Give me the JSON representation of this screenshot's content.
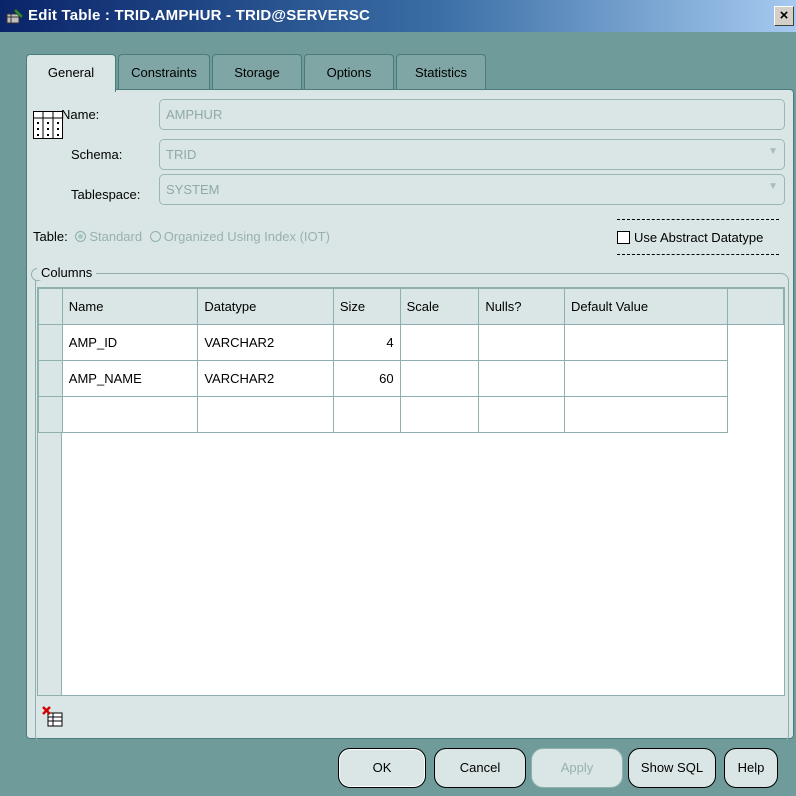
{
  "window": {
    "title": "Edit Table : TRID.AMPHUR - TRID@SERVERSC",
    "close_glyph": "×",
    "icon": "table-edit-icon"
  },
  "tabs": [
    {
      "label": "General",
      "active": true
    },
    {
      "label": "Constraints",
      "active": false
    },
    {
      "label": "Storage",
      "active": false
    },
    {
      "label": "Options",
      "active": false
    },
    {
      "label": "Statistics",
      "active": false
    }
  ],
  "general": {
    "name_label": "Name:",
    "name_value": "AMPHUR",
    "schema_label": "Schema:",
    "schema_value": "TRID",
    "tablespace_label": "Tablespace:",
    "tablespace_value": "SYSTEM",
    "table_type_label": "Table:",
    "table_type_options": [
      {
        "label": "Standard",
        "selected": true
      },
      {
        "label": "Organized Using Index (IOT)",
        "selected": false
      }
    ],
    "abstract_label": "Use Abstract Datatype",
    "abstract_checked": false
  },
  "columns": {
    "group_label": "Columns",
    "headers": [
      "Name",
      "Datatype",
      "Size",
      "Scale",
      "Nulls?",
      "Default Value"
    ],
    "rows": [
      [
        "AMP_ID",
        "VARCHAR2",
        "4",
        "",
        "",
        ""
      ],
      [
        "AMP_NAME",
        "VARCHAR2",
        "60",
        "",
        "",
        ""
      ],
      [
        "",
        "",
        "",
        "",
        "",
        ""
      ]
    ]
  },
  "buttons": {
    "ok": "OK",
    "cancel": "Cancel",
    "apply": "Apply",
    "show_sql": "Show SQL",
    "help": "Help"
  },
  "colors": {
    "frame": "#6f9b9b",
    "panel": "#d9e6e5",
    "title_bar": "#0a246a"
  }
}
